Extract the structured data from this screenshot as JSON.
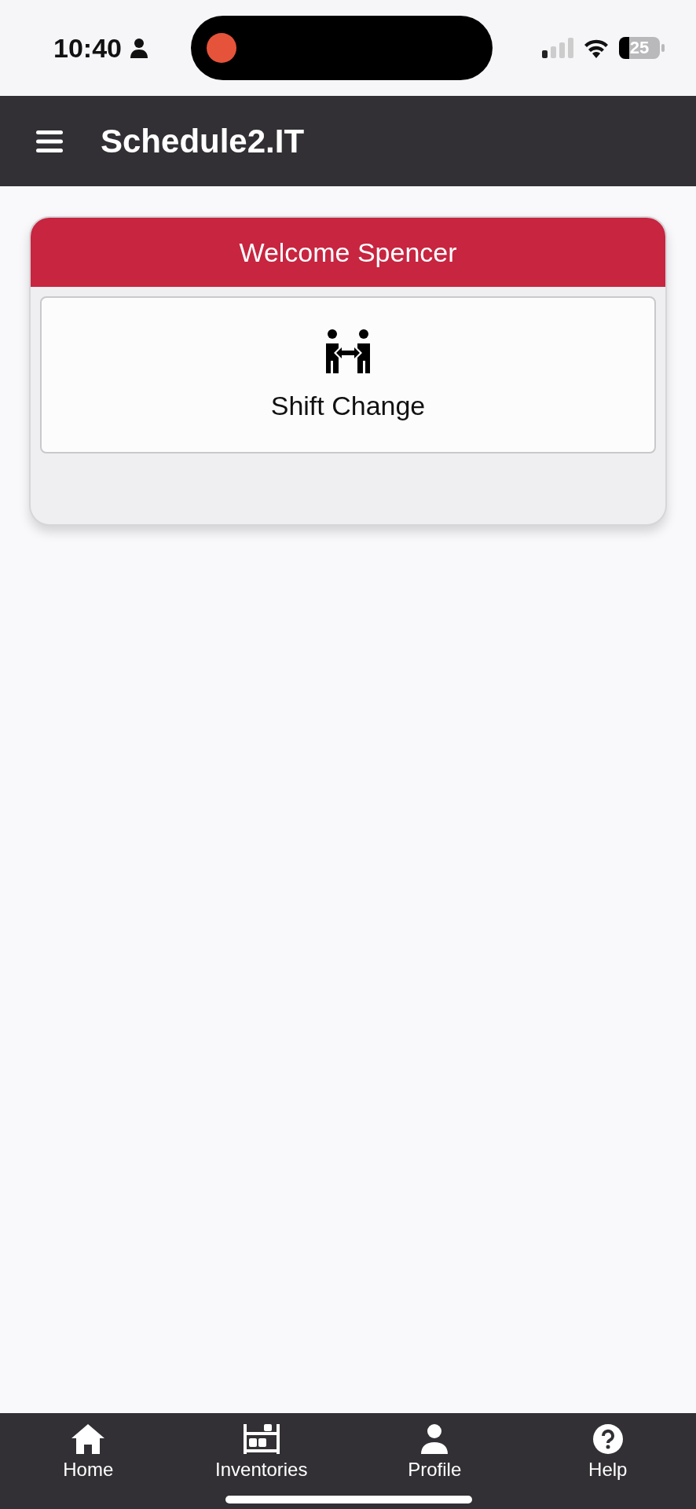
{
  "status_bar": {
    "time": "10:40",
    "battery": "25"
  },
  "header": {
    "title": "Schedule2.IT"
  },
  "welcome_card": {
    "title": "Welcome Spencer",
    "actions": [
      {
        "label": "Shift Change"
      }
    ]
  },
  "tab_bar": [
    {
      "kind": "home",
      "label": "Home"
    },
    {
      "kind": "inventory",
      "label": "Inventories"
    },
    {
      "kind": "profile",
      "label": "Profile"
    },
    {
      "kind": "help",
      "label": "Help"
    }
  ]
}
